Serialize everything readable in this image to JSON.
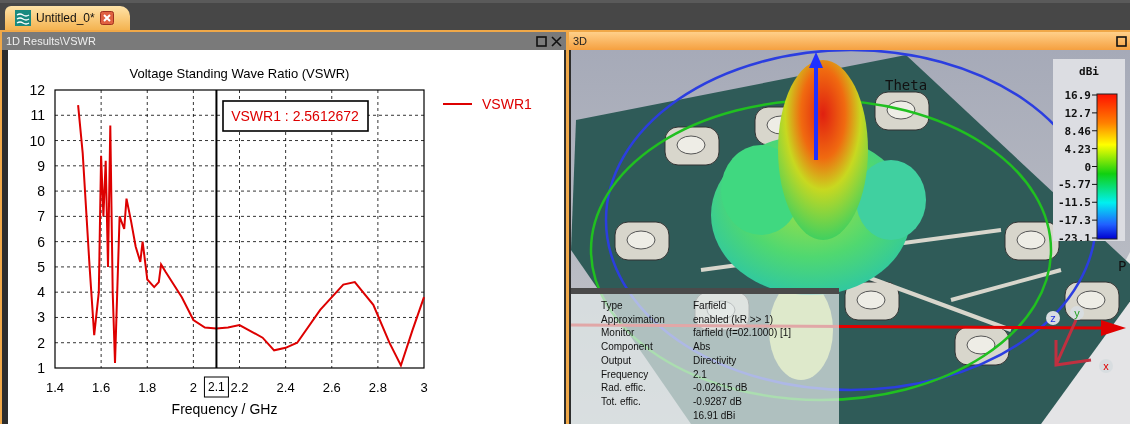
{
  "tabs": [
    {
      "label": "Untitled_0*",
      "selected": true
    }
  ],
  "left_panel": {
    "title": "1D Results\\VSWR",
    "chart_data": {
      "type": "line",
      "title": "Voltage Standing Wave Ratio (VSWR)",
      "xlabel": "Frequency / GHz",
      "x": [
        1.5,
        1.52,
        1.55,
        1.57,
        1.59,
        1.6,
        1.61,
        1.62,
        1.63,
        1.64,
        1.65,
        1.66,
        1.68,
        1.7,
        1.71,
        1.73,
        1.75,
        1.77,
        1.78,
        1.8,
        1.83,
        1.85,
        1.86,
        1.88,
        1.95,
        2.0,
        2.05,
        2.1,
        2.15,
        2.2,
        2.3,
        2.35,
        2.4,
        2.45,
        2.55,
        2.65,
        2.7,
        2.78,
        2.85,
        2.9,
        2.95,
        3.0
      ],
      "series": [
        {
          "name": "VSWR1",
          "color": "#dd0000",
          "values": [
            11.4,
            9.5,
            5.0,
            2.3,
            4.0,
            9.4,
            7.0,
            9.2,
            5.0,
            10.6,
            4.0,
            1.2,
            7.0,
            6.5,
            7.7,
            6.8,
            5.8,
            5.2,
            6.0,
            4.5,
            4.2,
            4.4,
            5.1,
            4.8,
            3.8,
            2.9,
            2.6,
            2.56,
            2.6,
            2.7,
            2.2,
            1.7,
            1.8,
            2.0,
            3.3,
            4.3,
            4.4,
            3.5,
            2.0,
            1.1,
            2.5,
            3.8
          ]
        }
      ],
      "xlim": [
        1.4,
        3
      ],
      "ylim": [
        1,
        12
      ],
      "xticks": [
        1.4,
        1.6,
        1.8,
        2,
        2.2,
        2.4,
        2.6,
        2.8,
        3
      ],
      "yticks": [
        1,
        2,
        3,
        4,
        5,
        6,
        7,
        8,
        9,
        10,
        11,
        12
      ],
      "grid": true,
      "ref_lines": [
        {
          "axis": "x",
          "value": 2.1,
          "label": "2.1"
        }
      ],
      "annotations": [
        "VSWR1 : 2.5612672"
      ]
    }
  },
  "right_panel": {
    "title": "3D",
    "axis_labels": [
      "Theta",
      "P"
    ],
    "triad": [
      "z",
      "y",
      "x"
    ],
    "colorbar": {
      "unit": "dBi",
      "labels": [
        "16.9",
        "12.7",
        "8.46",
        "4.23",
        "0",
        "-5.77",
        "-11.5",
        "-17.3",
        "-23.1"
      ]
    },
    "info": [
      {
        "label": "Type",
        "value": "Farfield"
      },
      {
        "label": "Approximation",
        "value": "enabled (kR >> 1)"
      },
      {
        "label": "Monitor",
        "value": "farfield (f=02.1000) [1]"
      },
      {
        "label": "Component",
        "value": "Abs"
      },
      {
        "label": "Output",
        "value": "Directivity"
      },
      {
        "label": "Frequency",
        "value": "2.1"
      },
      {
        "label": "Rad. effic.",
        "value": "-0.02615 dB"
      },
      {
        "label": "Tot. effic.",
        "value": "-0.9287 dB"
      },
      {
        "value": "16.91 dBi"
      }
    ]
  }
}
